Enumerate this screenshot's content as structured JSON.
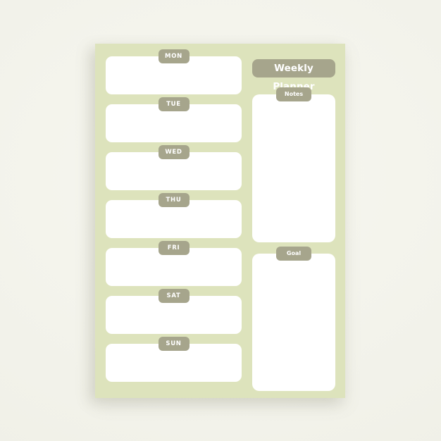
{
  "document": {
    "title": "Weekly Planner",
    "type": "weekly-planner-template"
  },
  "colors": {
    "canvas_background": "#f4f4ec",
    "sheet_background": "#dde3bc",
    "pill_background": "#a6a58c",
    "box_background": "#ffffff",
    "pill_text": "#ffffff"
  },
  "header": {
    "title": "Weekly Planner"
  },
  "days": [
    {
      "label": "MON",
      "content": ""
    },
    {
      "label": "TUE",
      "content": ""
    },
    {
      "label": "WED",
      "content": ""
    },
    {
      "label": "THU",
      "content": ""
    },
    {
      "label": "FRI",
      "content": ""
    },
    {
      "label": "SAT",
      "content": ""
    },
    {
      "label": "SUN",
      "content": ""
    }
  ],
  "panels": [
    {
      "label": "Notes",
      "content": ""
    },
    {
      "label": "Goal",
      "content": ""
    }
  ]
}
